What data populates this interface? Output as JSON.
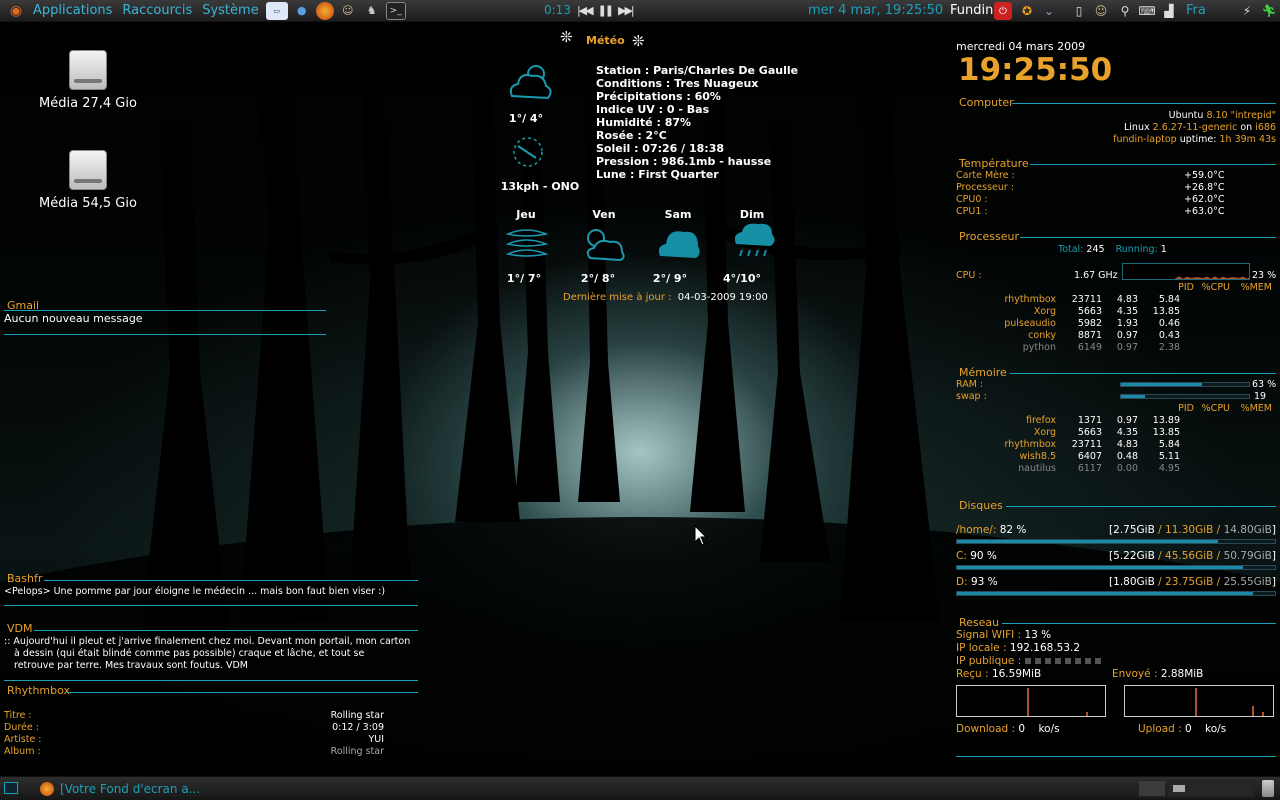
{
  "colors": {
    "accent": "#1aa0b8",
    "orange": "#e8a22c",
    "panel": "#2a2a2a"
  },
  "top_panel": {
    "menus": [
      "Applications",
      "Raccourcis",
      "Système"
    ],
    "launchers": [
      "ubuntu-logo-icon",
      "firefox-icon",
      "contacts-icon",
      "game-icon",
      "terminal-icon"
    ],
    "player_time": "0:13",
    "clock": "mer  4 mar, 19:25:50",
    "user": "Fundin",
    "lang": "Fra"
  },
  "desktop": {
    "icons": [
      {
        "label": "Média 27,4 Gio"
      },
      {
        "label": "Média 54,5 Gio"
      }
    ]
  },
  "weather": {
    "title": "Météo",
    "temp_now": "1°/ 4°",
    "wind": "13kph - ONO",
    "lines": [
      "Station : Paris/Charles De Gaulle",
      "Conditions : Tres Nuageux",
      "Précipitations : 60%",
      "Indice UV : 0 - Bas",
      "Humidité : 87%",
      "Rosée : 2°C",
      "Soleil : 07:26 / 18:38",
      "Pression : 986.1mb - hausse",
      "Lune : First Quarter"
    ],
    "days": [
      {
        "name": "Jeu",
        "temp": "1°/ 7°"
      },
      {
        "name": "Ven",
        "temp": "2°/ 8°"
      },
      {
        "name": "Sam",
        "temp": "2°/ 9°"
      },
      {
        "name": "Dim",
        "temp": "4°/10°"
      }
    ],
    "update_label": "Dernière mise à jour :",
    "update_value": "04-03-2009 19:00"
  },
  "gmail": {
    "title": "Gmail",
    "message": "Aucun nouveau message"
  },
  "bashfr": {
    "title": "Bashfr",
    "quote": "<Pelops> Une pomme par jour éloigne le médecin ... mais bon faut bien viser :)"
  },
  "vdm": {
    "title": "VDM",
    "lines": [
      ":: Aujourd'hui il pleut et j'arrive finalement chez moi. Devant mon portail, mon carton",
      "à dessin (qui était blindé comme pas possible) craque et lâche, et tout se",
      "retrouve par terre. Mes travaux sont foutus. VDM"
    ]
  },
  "rhythmbox": {
    "title": "Rhythmbox",
    "rows": [
      {
        "label": "Titre :",
        "value": "Rolling star"
      },
      {
        "label": "Durée :",
        "value": "0:12 / 3:09"
      },
      {
        "label": "Artiste :",
        "value": "YUI"
      },
      {
        "label": "Album :",
        "value": "Rolling star"
      }
    ]
  },
  "conky": {
    "date": "mercredi 04 mars 2009",
    "time": "19:25:50",
    "computer": {
      "title": "Computer",
      "os": "Ubuntu",
      "os_version": "8.10",
      "codename": "\"intrepid\"",
      "kernel_label": "Linux",
      "kernel": "2.6.27-11-generic",
      "on": "on",
      "arch": "i686",
      "host": "fundin-laptop",
      "uptime_label": "uptime:",
      "uptime": "1h 39m 43s"
    },
    "temperature": {
      "title": "Température",
      "rows": [
        {
          "label": "Carte Mère :",
          "value": "+59.0°C"
        },
        {
          "label": "Processeur :",
          "value": "+26.8°C"
        },
        {
          "label": "CPU0 :",
          "value": "+62.0°C"
        },
        {
          "label": "CPU1 :",
          "value": "+63.0°C"
        }
      ]
    },
    "processor": {
      "title": "Processeur",
      "total_label": "Total:",
      "total": "245",
      "running_label": "Running:",
      "running": "1",
      "cpu_label": "CPU   :",
      "freq": "1.67 GHz",
      "usage": "23 %",
      "usage_value": 23,
      "headers": [
        "PID",
        "%CPU",
        "%MEM"
      ],
      "procs": [
        [
          "rhythmbox",
          "23711",
          "4.83",
          "5.84"
        ],
        [
          "Xorg",
          "5663",
          "4.35",
          "13.85"
        ],
        [
          "pulseaudio",
          "5982",
          "1.93",
          "0.46"
        ],
        [
          "conky",
          "8871",
          "0.97",
          "0.43"
        ],
        [
          "python",
          "6149",
          "0.97",
          "2.38"
        ]
      ]
    },
    "memory": {
      "title": "Mémoire",
      "ram_label": "RAM   :",
      "ram": "63 %",
      "ram_value": 63,
      "swap_label": "swap  :",
      "swap": "19",
      "swap_value": 19,
      "headers": [
        "PID",
        "%CPU",
        "%MEM"
      ],
      "procs": [
        [
          "firefox",
          "1371",
          "0.97",
          "13.89"
        ],
        [
          "Xorg",
          "5663",
          "4.35",
          "13.85"
        ],
        [
          "rhythmbox",
          "23711",
          "4.83",
          "5.84"
        ],
        [
          "wish8.5",
          "6407",
          "0.48",
          "5.11"
        ],
        [
          "nautilus",
          "6117",
          "0.00",
          "4.95"
        ]
      ]
    },
    "disks": {
      "title": "Disques",
      "items": [
        {
          "name": "/home/:",
          "pct": "82  %",
          "used": "2.75GiB",
          "free": "11.30GiB",
          "total": "14.80GiB",
          "value": 82
        },
        {
          "name": "C:",
          "pct": "90  %",
          "used": "5.22GiB",
          "free": "45.56GiB",
          "total": "50.79GiB",
          "value": 90
        },
        {
          "name": "D:",
          "pct": "93  %",
          "used": "1.80GiB",
          "free": "23.75GiB",
          "total": "25.55GiB",
          "value": 93
        }
      ]
    },
    "network": {
      "title": "Reseau",
      "wifi_label": "Signal WIFI :",
      "wifi": "13 %",
      "ip_local_label": "IP locale :",
      "ip_local": "192.168.53.2",
      "ip_public_label": "IP publique :",
      "recv_label": "Reçu :",
      "recv": "16.59MiB",
      "sent_label": "Envoyé :",
      "sent": "2.88MiB",
      "down_label": "Download :",
      "down": "0",
      "down_unit": "ko/s",
      "up_label": "Upload :",
      "up": "0",
      "up_unit": "ko/s"
    }
  },
  "bottom_panel": {
    "task": "[Votre Fond d'ecran a..."
  }
}
